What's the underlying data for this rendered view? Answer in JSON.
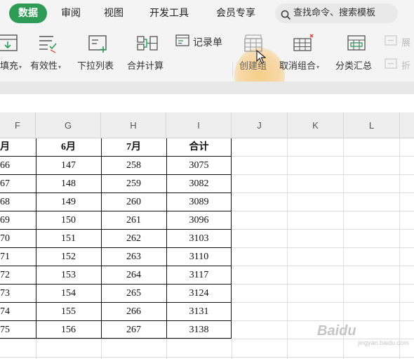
{
  "menu": {
    "tabs": [
      {
        "label": "数据",
        "active": true
      },
      {
        "label": "审阅"
      },
      {
        "label": "视图"
      },
      {
        "label": "开发工具"
      },
      {
        "label": "会员专享"
      }
    ],
    "search_text": "查找命令、搜索模板"
  },
  "toolbar": {
    "fill_label": "填充",
    "validity_label": "有效性",
    "dropdown_label": "下拉列表",
    "merge_calc_label": "合并计算",
    "record_label": "记录单",
    "create_group_label": "创建组",
    "ungroup_label": "取消组合",
    "subtotal_label": "分类汇总",
    "expand_label": "展",
    "fold_label": "折"
  },
  "columns": [
    "F",
    "G",
    "H",
    "I",
    "J",
    "K",
    "L"
  ],
  "table": {
    "headers": [
      "月",
      "6月",
      "7月",
      "合计"
    ],
    "rows": [
      [
        "66",
        "147",
        "258",
        "3075"
      ],
      [
        "67",
        "148",
        "259",
        "3082"
      ],
      [
        "68",
        "149",
        "260",
        "3089"
      ],
      [
        "69",
        "150",
        "261",
        "3096"
      ],
      [
        "70",
        "151",
        "262",
        "3103"
      ],
      [
        "71",
        "152",
        "263",
        "3110"
      ],
      [
        "72",
        "153",
        "264",
        "3117"
      ],
      [
        "73",
        "154",
        "265",
        "3124"
      ],
      [
        "74",
        "155",
        "266",
        "3131"
      ],
      [
        "75",
        "156",
        "267",
        "3138"
      ]
    ]
  },
  "watermark": {
    "brand": "Baidu",
    "sub": "jingyan.baidu.com"
  },
  "colors": {
    "accent": "#2e9b57",
    "highlight": "#f8c878",
    "table_border": "#111111"
  }
}
